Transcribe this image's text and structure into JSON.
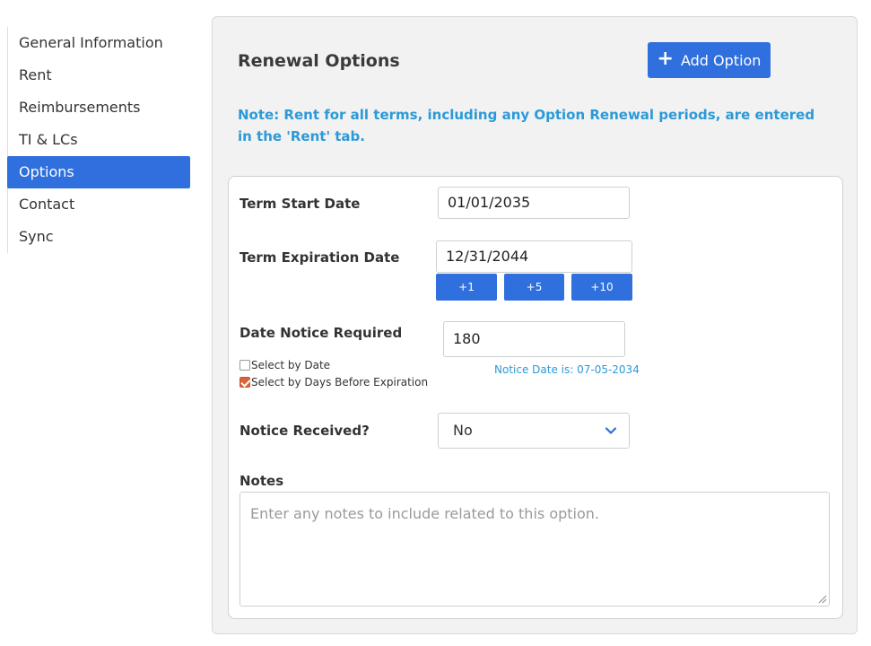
{
  "sidebar": {
    "items": [
      {
        "label": "General Information",
        "active": false
      },
      {
        "label": "Rent",
        "active": false
      },
      {
        "label": "Reimbursements",
        "active": false
      },
      {
        "label": "TI & LCs",
        "active": false
      },
      {
        "label": "Options",
        "active": true
      },
      {
        "label": "Contact",
        "active": false
      },
      {
        "label": "Sync",
        "active": false
      }
    ]
  },
  "panel": {
    "title": "Renewal Options",
    "add_button_label": "Add Option",
    "add_button_icon": "plus-icon",
    "note": "Note: Rent for all terms, including any Option Renewal periods, are entered in the 'Rent' tab."
  },
  "form": {
    "term_start_label": "Term Start Date",
    "term_start_value": "01/01/2035",
    "term_expiration_label": "Term Expiration Date",
    "term_expiration_value": "12/31/2044",
    "increment_buttons": [
      "+1",
      "+5",
      "+10"
    ],
    "notice_required_label": "Date Notice Required",
    "notice_days_value": "180",
    "select_by_date_label": "Select by Date",
    "select_by_date_checked": false,
    "select_by_days_label": "Select by Days Before Expiration",
    "select_by_days_checked": true,
    "notice_date_text": "Notice Date is: 07-05-2034",
    "notice_received_label": "Notice Received?",
    "notice_received_value": "No",
    "notes_label": "Notes",
    "notes_placeholder": "Enter any notes to include related to this option."
  },
  "colors": {
    "accent": "#2f6fde",
    "note_text": "#2b9ad8",
    "checkbox_checked": "#d9643a"
  }
}
